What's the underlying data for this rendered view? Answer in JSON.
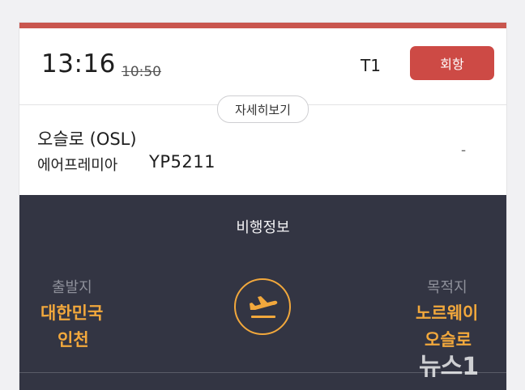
{
  "flight": {
    "time_changed": "13:16",
    "time_scheduled": "10:50",
    "terminal": "T1",
    "status": "회항",
    "details_button": "자세히보기",
    "destination": "오슬로 (OSL)",
    "airline": "에어프레미아",
    "flight_number": "YP5211",
    "gate": "-"
  },
  "info": {
    "title": "비행정보",
    "origin_label": "출발지",
    "origin_country": "대한민국",
    "origin_city": "인천",
    "destination_label": "목적지",
    "destination_country": "노르웨이",
    "destination_city": "오슬로",
    "icon": "plane-takeoff-icon"
  },
  "watermark": {
    "text": "뉴스1"
  },
  "colors": {
    "status": "#cd4a45",
    "accent": "#f2a83c",
    "panel": "#333543"
  }
}
